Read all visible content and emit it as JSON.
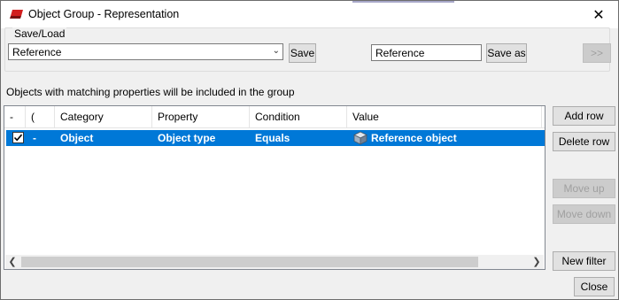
{
  "window": {
    "title": "Object Group - Representation",
    "close_glyph": "✕"
  },
  "saveload": {
    "legend": "Save/Load",
    "selected": "Reference",
    "save_label": "Save",
    "name_value": "Reference",
    "save_as_label": "Save as",
    "more_label": ">>"
  },
  "hint": "Objects with matching properties will be included in the group",
  "table": {
    "columns": [
      "-",
      "(",
      "Category",
      "Property",
      "Condition",
      "Value"
    ],
    "rows": [
      {
        "checked": true,
        "paren": "-",
        "category": "Object",
        "property": "Object type",
        "condition": "Equals",
        "value": "Reference object",
        "value_icon": "cube-icon"
      }
    ]
  },
  "actions": {
    "add_row": "Add row",
    "delete_row": "Delete row",
    "move_up": "Move up",
    "move_down": "Move down",
    "new_filter": "New filter",
    "close": "Close"
  },
  "colors": {
    "selection": "#0078d7",
    "brand_icon": "#d21f1f"
  }
}
